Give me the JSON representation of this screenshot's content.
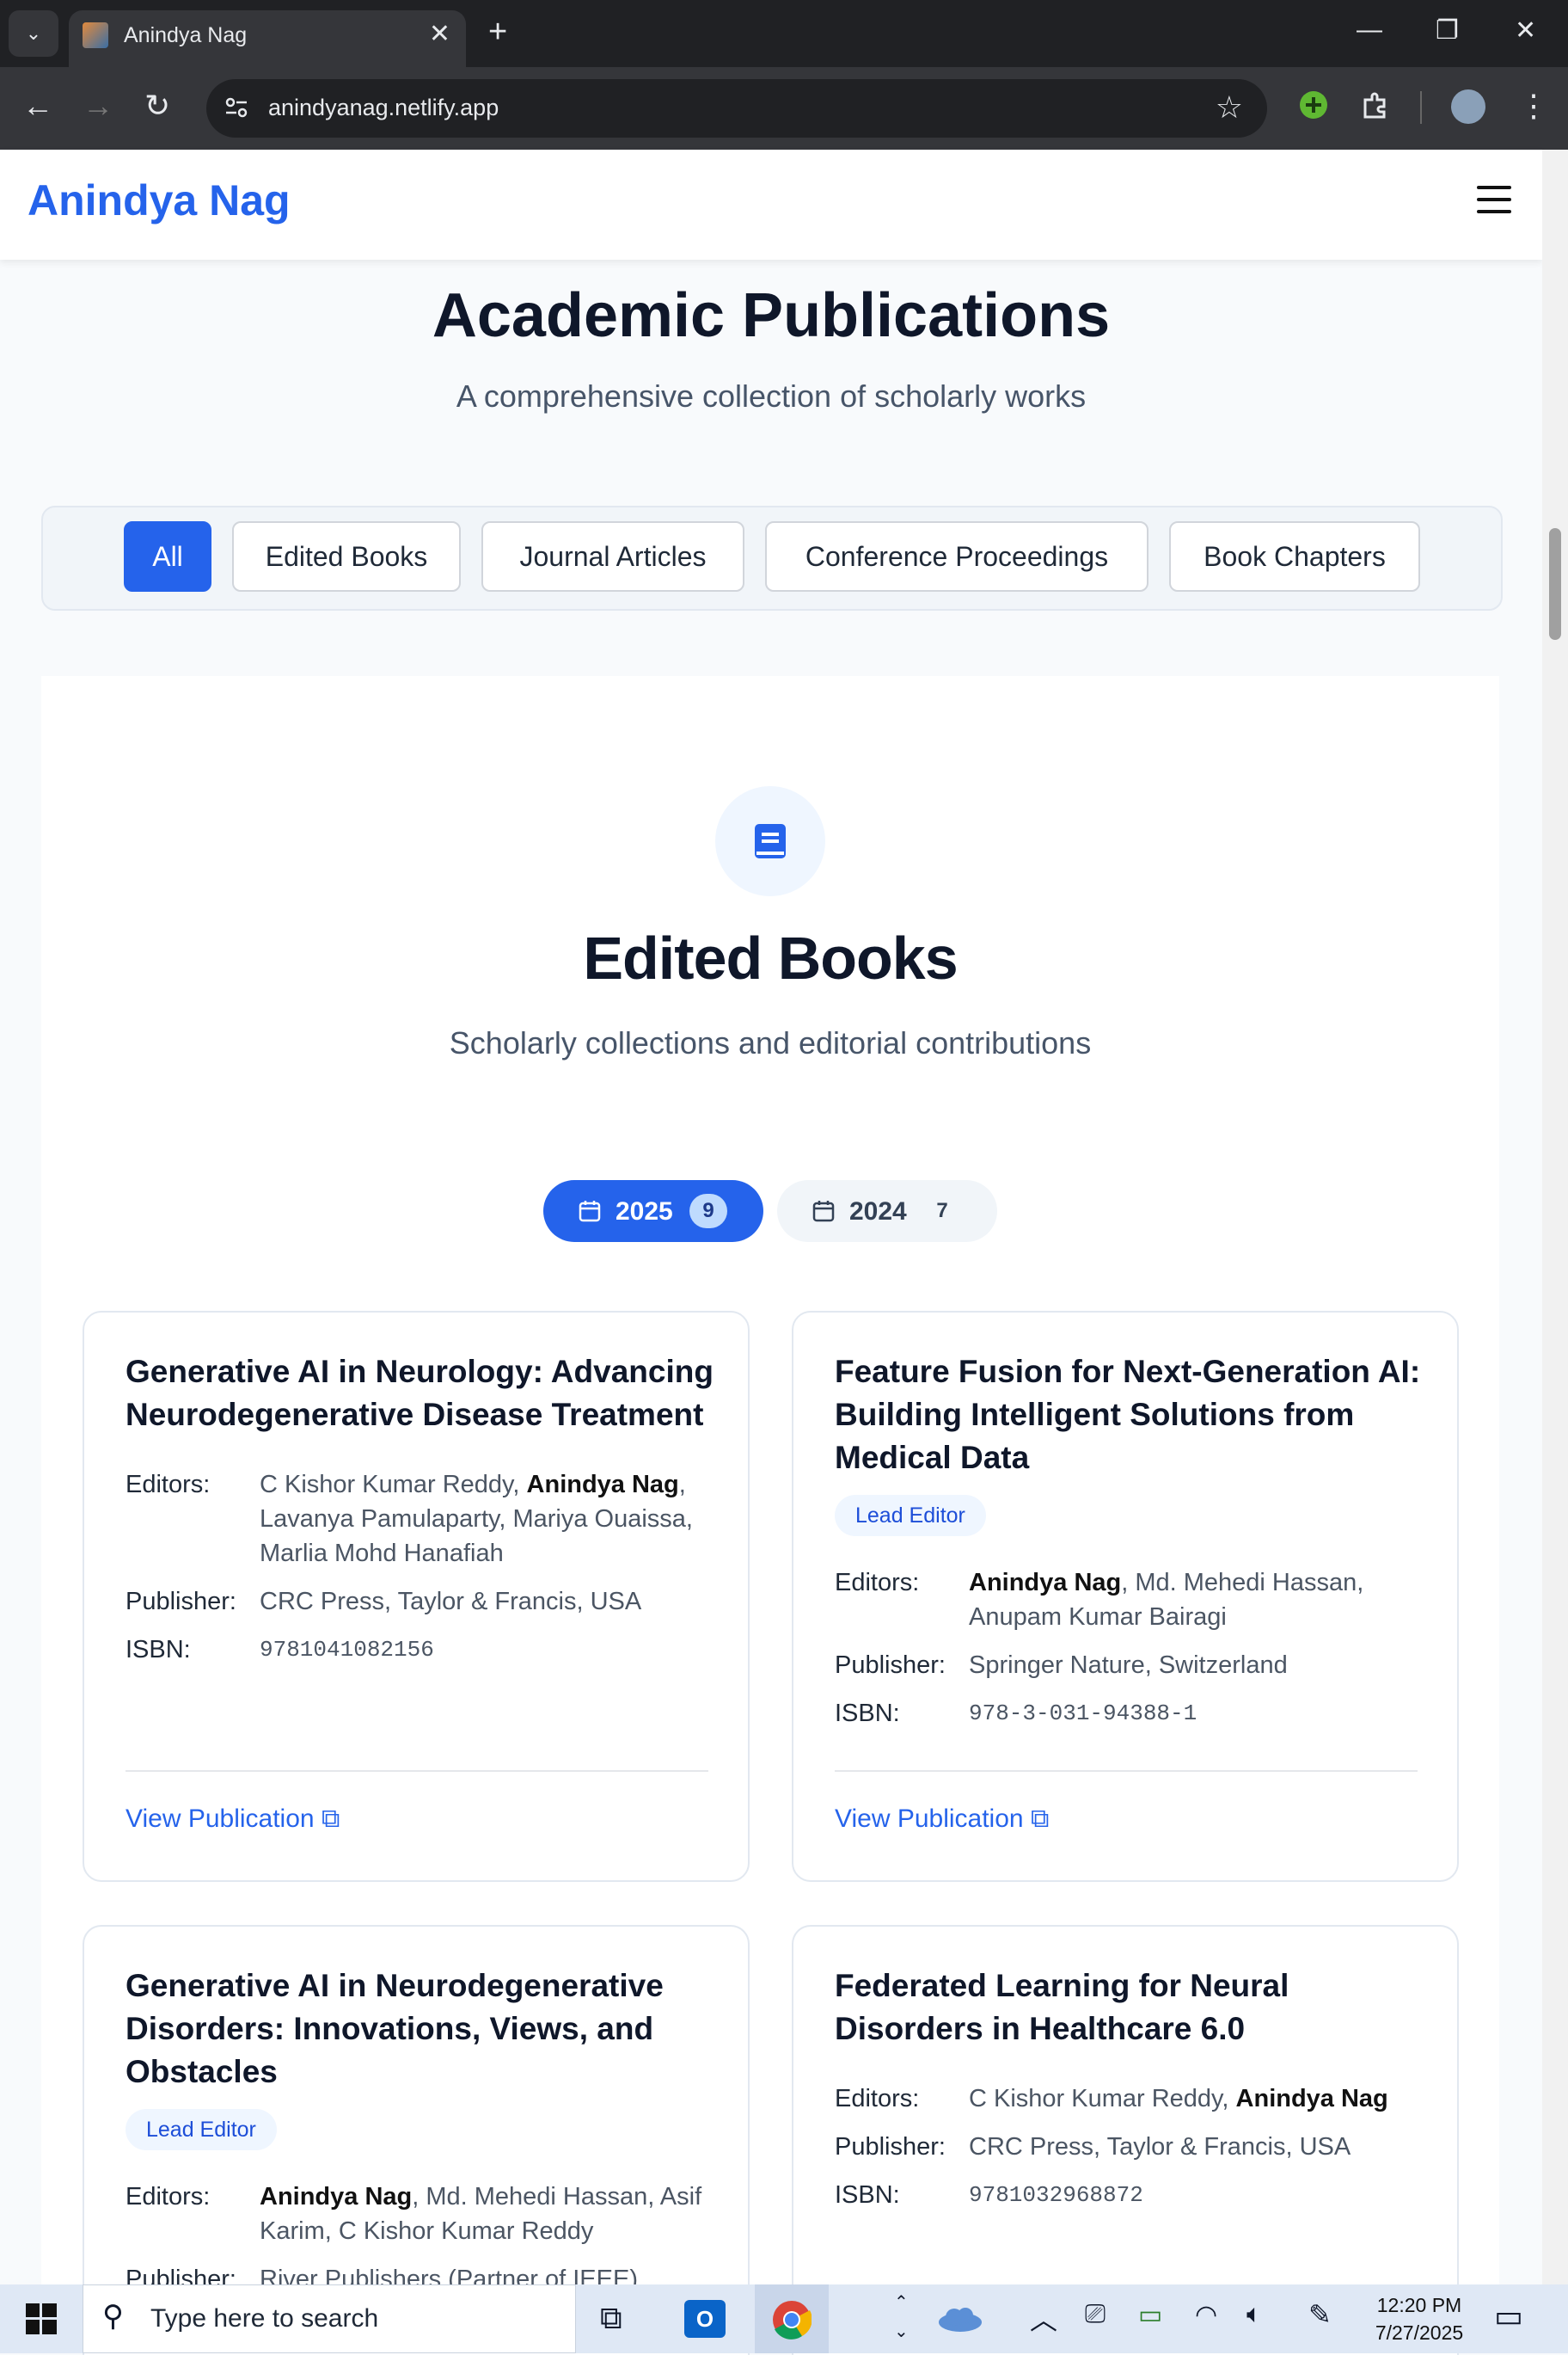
{
  "browser": {
    "tab_title": "Anindya Nag",
    "url": "anindyanag.netlify.app"
  },
  "site": {
    "brand": "Anindya Nag"
  },
  "page": {
    "title": "Academic Publications",
    "subtitle": "A comprehensive collection of scholarly works"
  },
  "filters": [
    "All",
    "Edited Books",
    "Journal Articles",
    "Conference Proceedings",
    "Book Chapters"
  ],
  "section": {
    "title": "Edited Books",
    "subtitle": "Scholarly collections and editorial contributions",
    "years": [
      {
        "label": "2025",
        "count": "9"
      },
      {
        "label": "2024",
        "count": "7"
      }
    ]
  },
  "labels": {
    "editors": "Editors:",
    "publisher": "Publisher:",
    "isbn": "ISBN:",
    "view": "View Publication",
    "lead": "Lead Editor"
  },
  "cards": [
    {
      "title": "Generative AI in Neurology: Advancing Neurodegenerative Disease Treatment",
      "editors_pre": "C Kishor Kumar Reddy, ",
      "editors_bold": "Anindya Nag",
      "editors_post": ", Lavanya Pamulaparty, Mariya Ouaissa, Marlia Mohd Hanafiah",
      "publisher": "CRC Press, Taylor & Francis, USA",
      "isbn": "9781041082156"
    },
    {
      "title": "Feature Fusion for Next-Generation AI: Building Intelligent Solutions from Medical Data",
      "editors_pre": "",
      "editors_bold": "Anindya Nag",
      "editors_post": ", Md. Mehedi Hassan, Anupam Kumar Bairagi",
      "publisher": "Springer Nature, Switzerland",
      "isbn": "978-3-031-94388-1"
    },
    {
      "title": "Generative AI in Neurodegenerative Disorders: Innovations, Views, and Obstacles",
      "editors_pre": "",
      "editors_bold": "Anindya Nag",
      "editors_post": ", Md. Mehedi Hassan, Asif Karim, C Kishor Kumar Reddy",
      "publisher": "River Publishers (Partner of IEEE)"
    },
    {
      "title": "Federated Learning for Neural Disorders in Healthcare 6.0",
      "editors_pre": "C Kishor Kumar Reddy, ",
      "editors_bold": "Anindya Nag",
      "editors_post": "",
      "publisher": "CRC Press, Taylor & Francis, USA",
      "isbn": "9781032968872"
    }
  ],
  "taskbar": {
    "search_placeholder": "Type here to search",
    "time": "12:20 PM",
    "date": "7/27/2025"
  }
}
